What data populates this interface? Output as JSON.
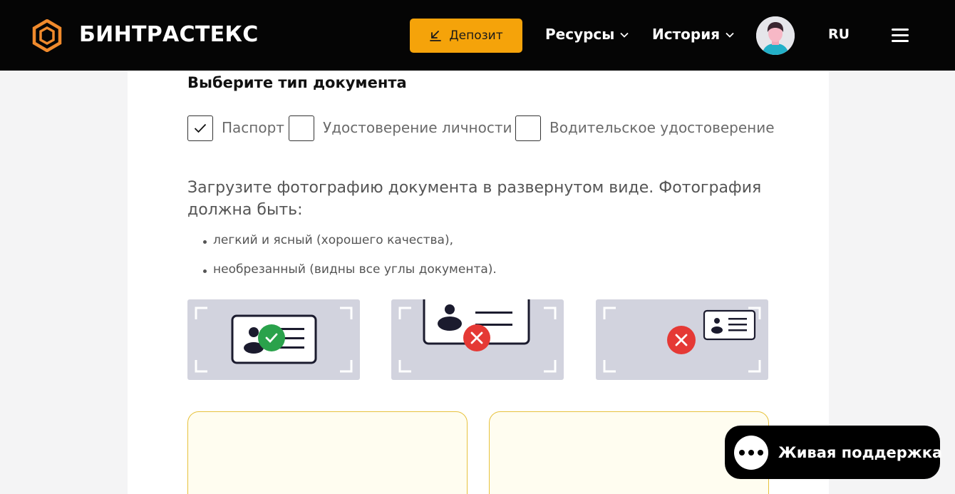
{
  "header": {
    "brand": "БИНТРАСТЕКС",
    "deposit_label": "Депозит",
    "nav": [
      {
        "label": "Ресурсы"
      },
      {
        "label": "История"
      }
    ],
    "lang": "RU"
  },
  "colors": {
    "header_bg": "#050505",
    "accent": "#f5a30a",
    "logo": "#f08a2c",
    "ok": "#2aa24b",
    "error": "#e53935",
    "dropzone_border": "#e7c23d",
    "dropzone_bg": "#fffdf0"
  },
  "document": {
    "title": "Выберите тип документа",
    "options": [
      {
        "label": "Паспорт",
        "checked": true
      },
      {
        "label": "Удостоверение личности",
        "checked": false
      },
      {
        "label": "Водительское удостоверение",
        "checked": false
      }
    ]
  },
  "upload": {
    "instruction": "Загрузите фотографию документа в развернутом виде. Фотография должна быть:",
    "requirements": [
      "легкий и ясный (хорошего качества),",
      "необрезанный (видны все углы документа)."
    ],
    "examples": [
      {
        "status": "correct",
        "icon": "check-icon"
      },
      {
        "status": "cropped",
        "icon": "cross-icon"
      },
      {
        "status": "too-small",
        "icon": "cross-icon"
      }
    ]
  },
  "support": {
    "label": "Живая поддержка"
  }
}
